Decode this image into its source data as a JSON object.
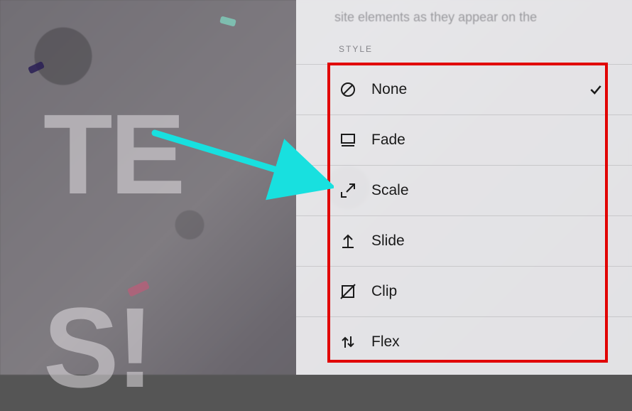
{
  "panel": {
    "blurb": "site elements as they appear on the",
    "section_label": "STYLE",
    "options": [
      {
        "id": "none",
        "label": "None",
        "selected": true
      },
      {
        "id": "fade",
        "label": "Fade",
        "selected": false
      },
      {
        "id": "scale",
        "label": "Scale",
        "selected": false
      },
      {
        "id": "slide",
        "label": "Slide",
        "selected": false
      },
      {
        "id": "clip",
        "label": "Clip",
        "selected": false
      },
      {
        "id": "flex",
        "label": "Flex",
        "selected": false
      }
    ]
  },
  "background": {
    "ghost_text_line1": "TE",
    "ghost_text_line2": "S!"
  },
  "annotation": {
    "highlight_color": "#e10000",
    "arrow_color": "#18e0df",
    "arrow_target": "scale"
  }
}
